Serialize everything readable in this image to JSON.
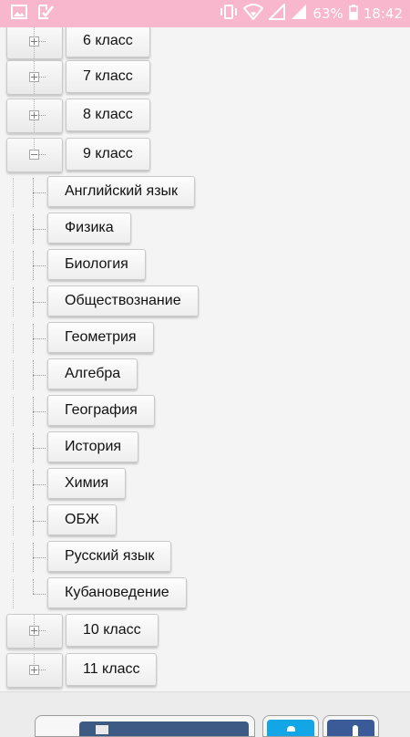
{
  "status_bar": {
    "battery": "63%",
    "time": "18:42",
    "icons": [
      "image-icon",
      "checklist-icon",
      "vibrate-icon",
      "wifi-icon",
      "signal-icon",
      "signal-icon",
      "battery-icon"
    ]
  },
  "tree": {
    "grades": [
      {
        "label": "6 класс",
        "expanded": false
      },
      {
        "label": "7 класс",
        "expanded": false
      },
      {
        "label": "8 класс",
        "expanded": false
      },
      {
        "label": "9 класс",
        "expanded": true
      },
      {
        "label": "10 класс",
        "expanded": false
      },
      {
        "label": "11 класс",
        "expanded": false
      }
    ],
    "subjects": [
      "Английский язык",
      "Физика",
      "Биология",
      "Обществознание",
      "Геометрия",
      "Алгебра",
      "География",
      "История",
      "Химия",
      "ОБЖ",
      "Русский язык",
      "Кубановедение"
    ]
  },
  "colors": {
    "status_bar": "#f8b7cd",
    "twitter": "#12a6e6",
    "facebook": "#3b5a98",
    "vk": "#3d5a85"
  },
  "bottom_bar": {
    "icons": [
      "share-icon",
      "twitter-icon",
      "facebook-icon"
    ]
  }
}
